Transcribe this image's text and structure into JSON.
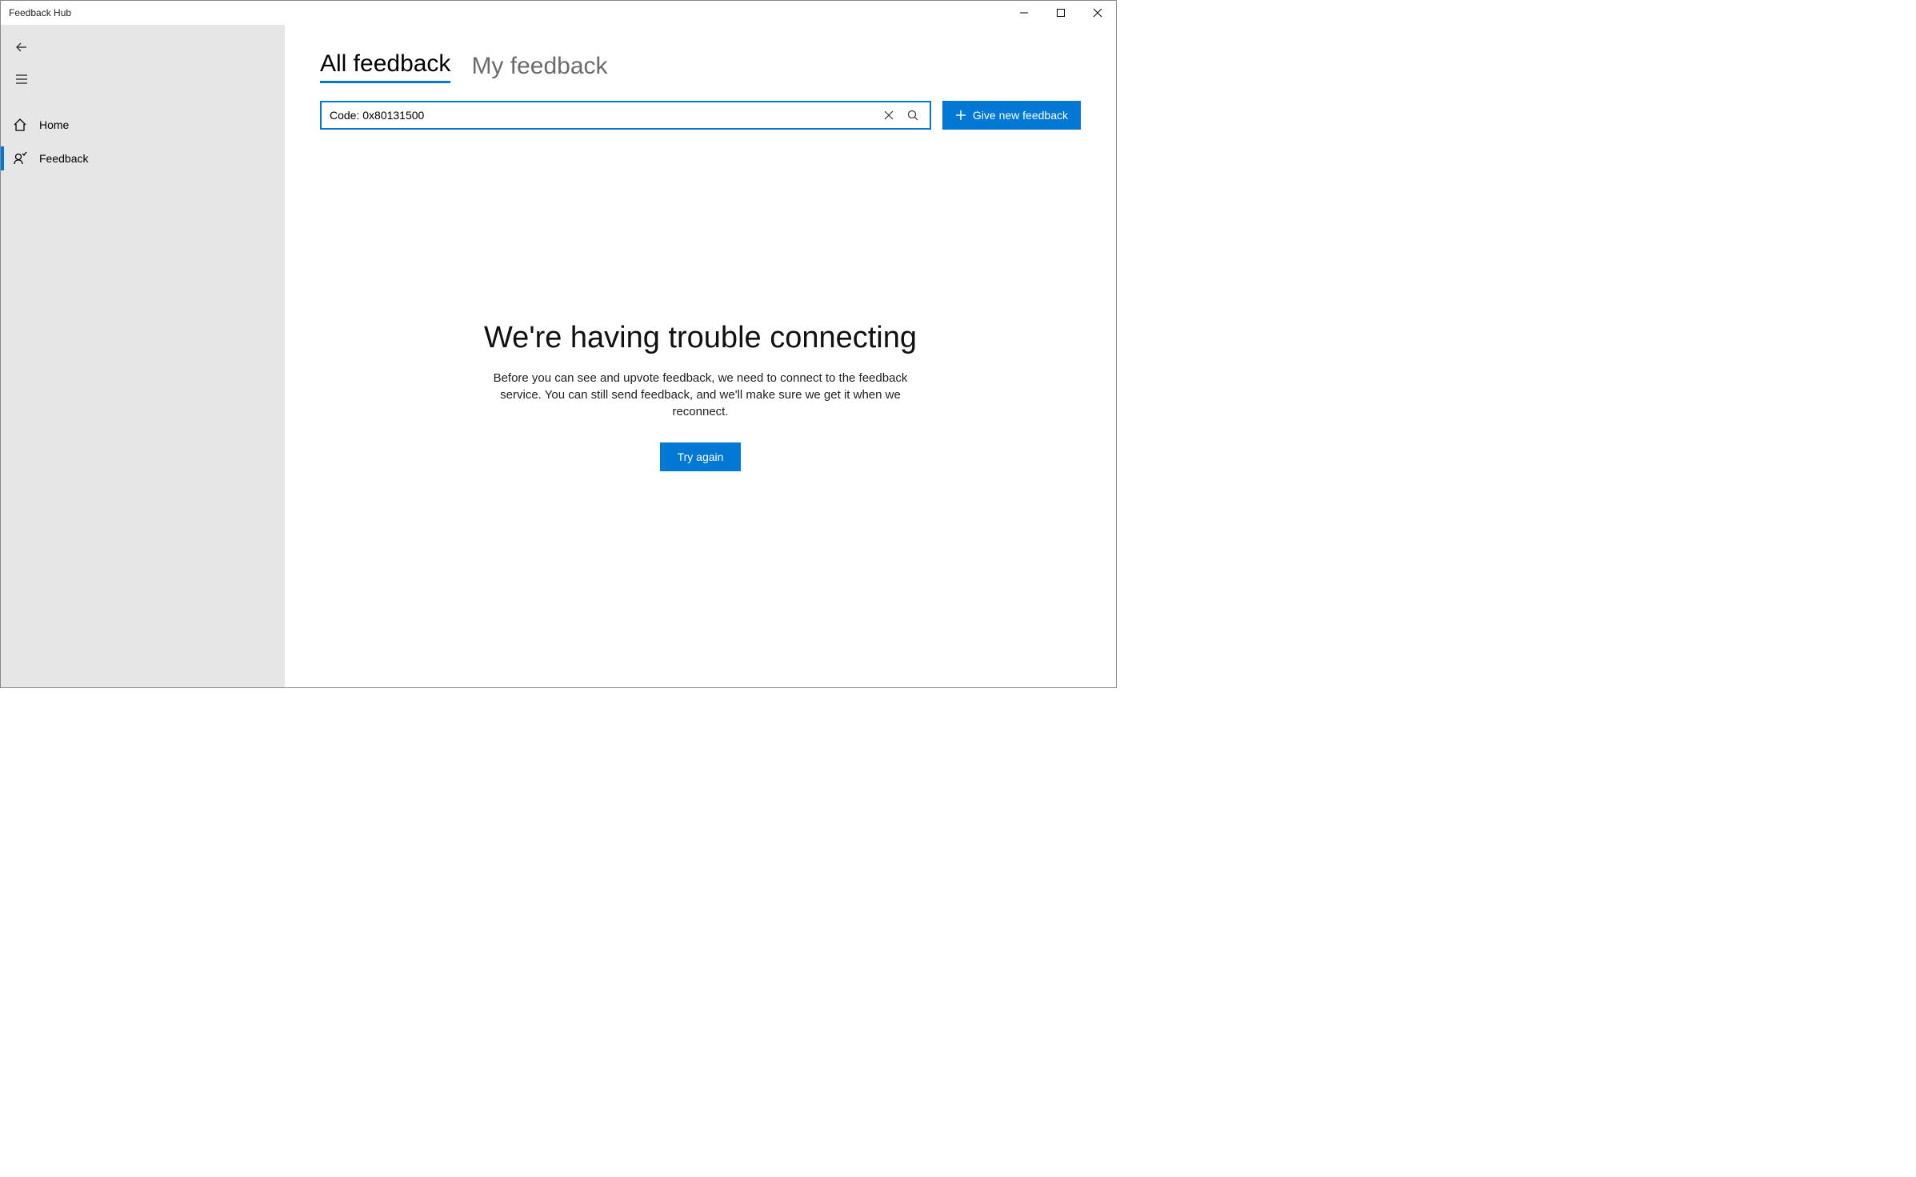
{
  "window": {
    "title": "Feedback Hub"
  },
  "sidebar": {
    "items": [
      {
        "label": "Home"
      },
      {
        "label": "Feedback"
      }
    ]
  },
  "tabs": {
    "all": "All feedback",
    "my": "My feedback"
  },
  "search": {
    "value": "Code: 0x80131500"
  },
  "actions": {
    "give_feedback": "Give new feedback"
  },
  "error": {
    "heading": "We're having trouble connecting",
    "body": "Before you can see and upvote feedback, we need to connect to the feedback service. You can still send feedback, and we'll make sure we get it when we reconnect.",
    "retry": "Try again"
  }
}
